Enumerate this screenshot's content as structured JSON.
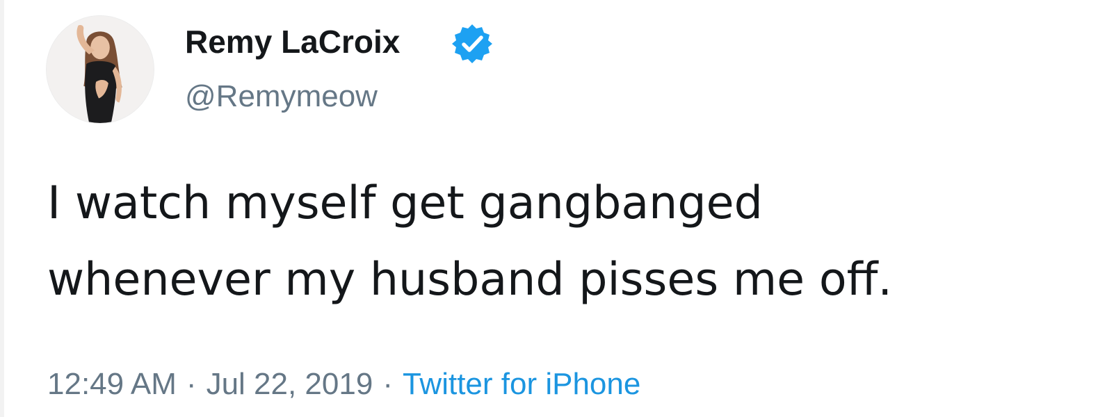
{
  "author": {
    "display_name": "Remy LaCroix",
    "handle": "@Remymeow",
    "verified": true,
    "verified_icon": "verified-badge-icon"
  },
  "tweet": {
    "text_lines": [
      "I watch myself get gangbanged",
      "whenever my husband pisses me off."
    ]
  },
  "meta": {
    "time": "12:49 AM",
    "separator": "·",
    "date": "Jul 22, 2019",
    "source": "Twitter for iPhone"
  },
  "colors": {
    "text_primary": "#14171a",
    "text_secondary": "#657786",
    "link": "#1b95e0",
    "verified_badge": "#1da1f2"
  }
}
